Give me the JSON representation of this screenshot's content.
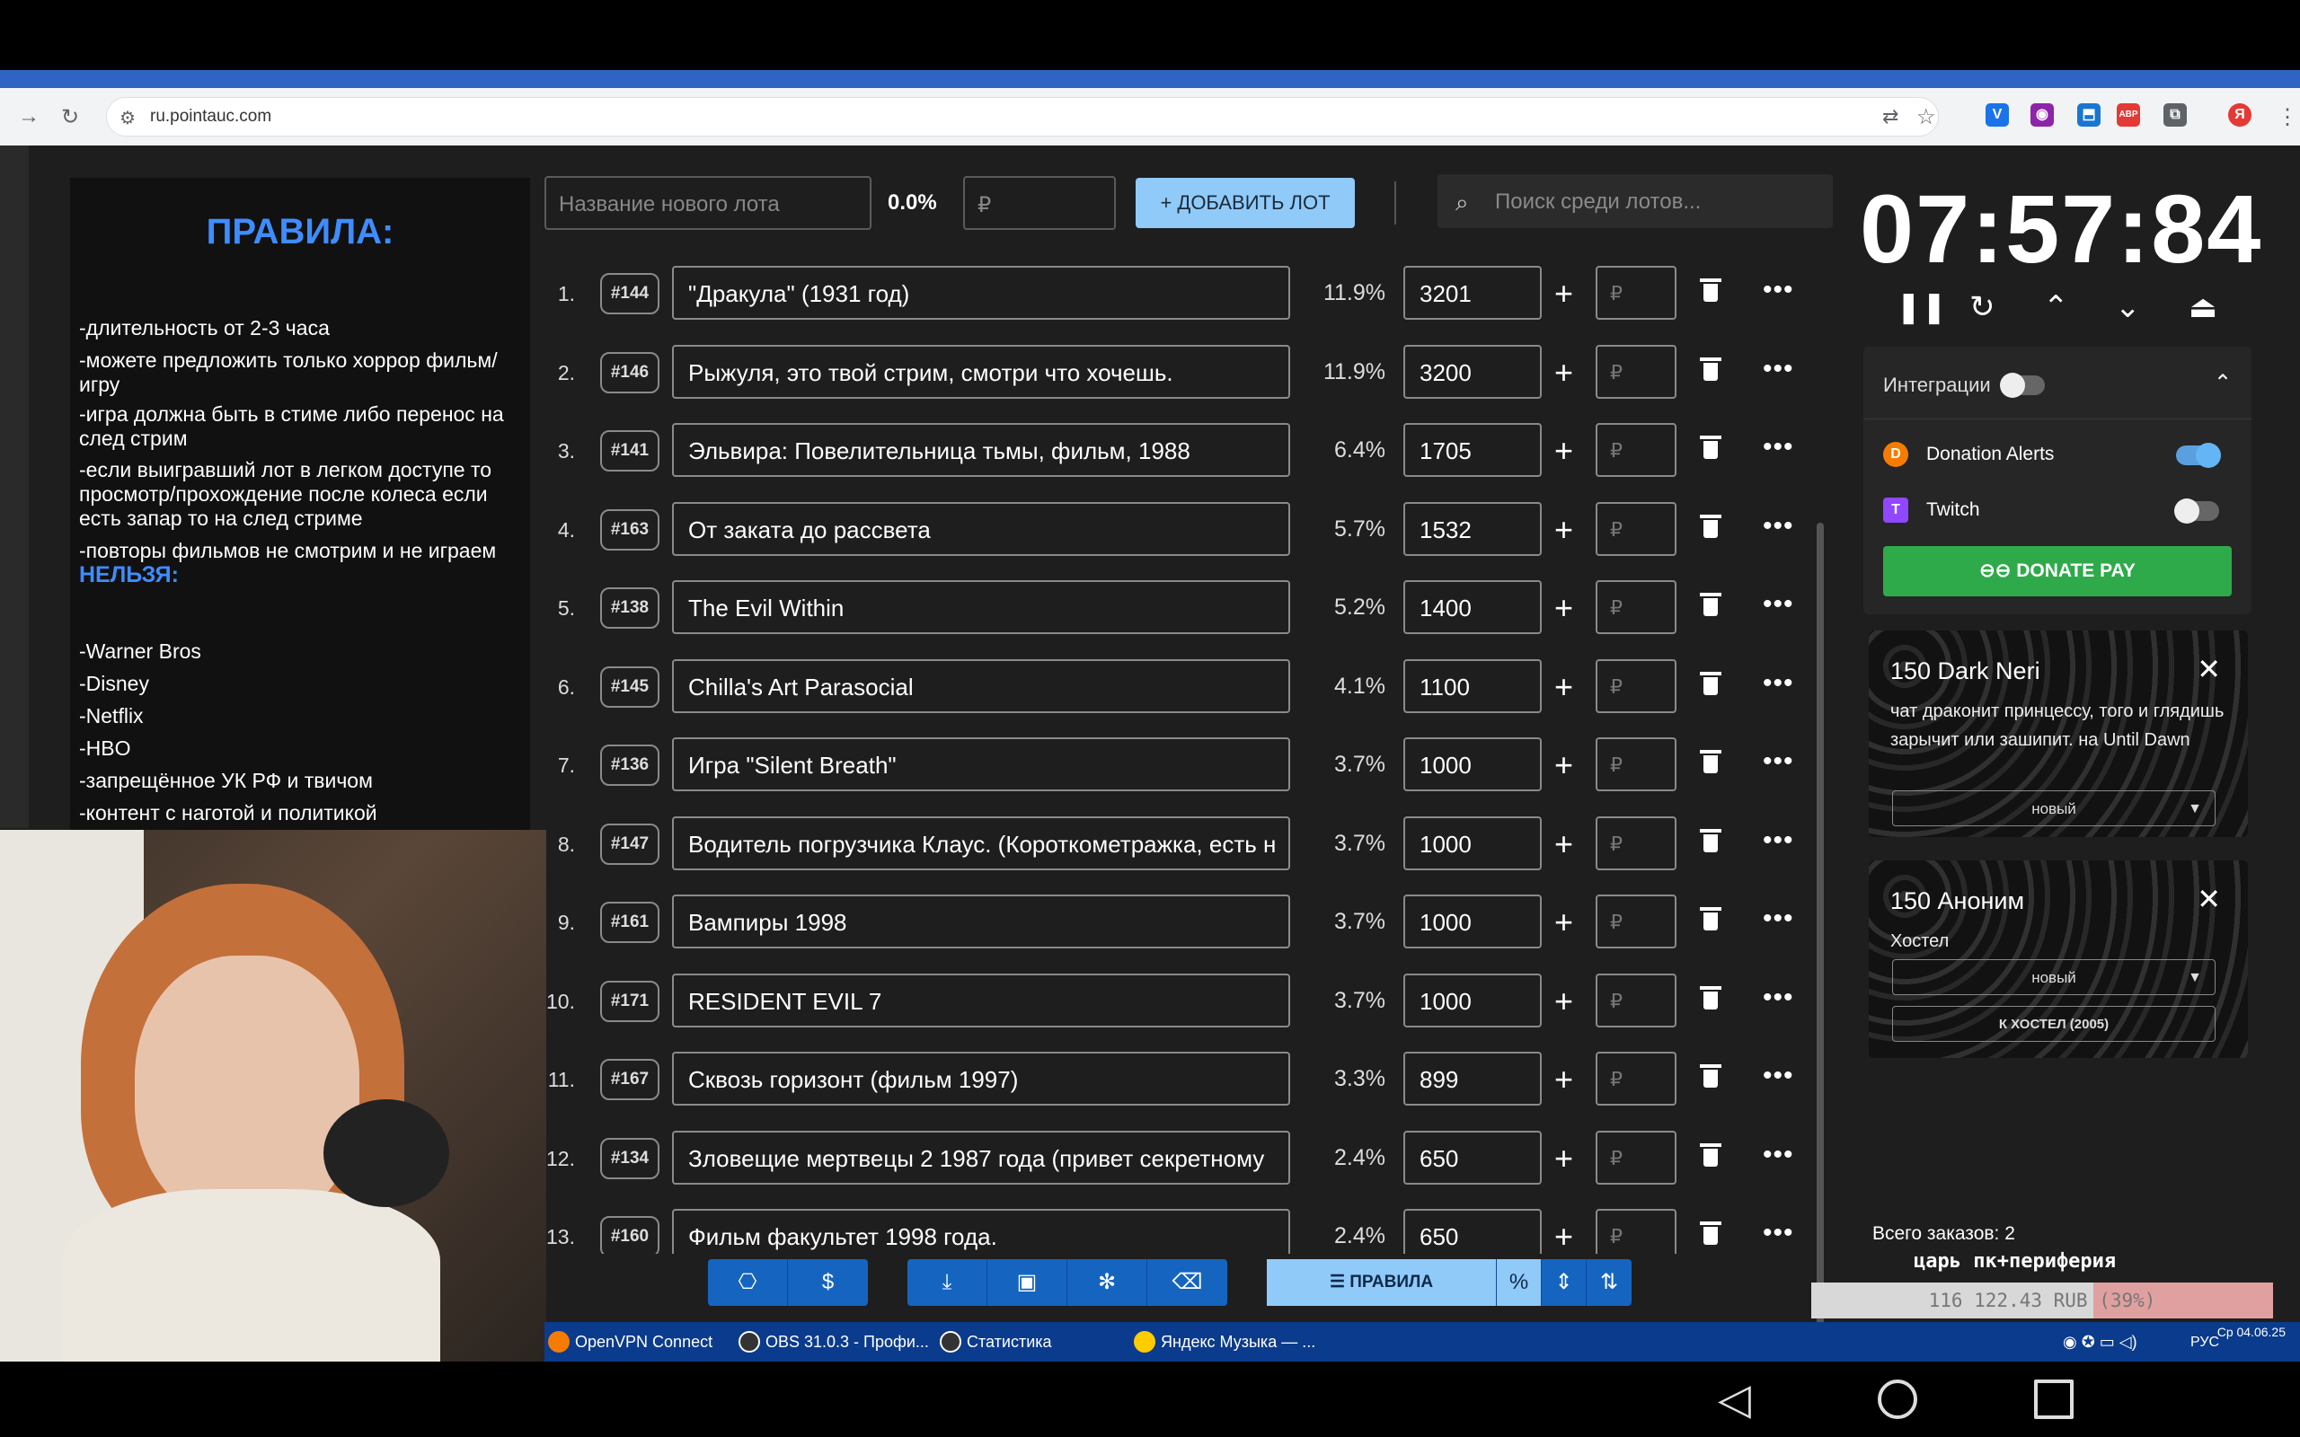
{
  "browser": {
    "url": "ru.pointauc.com",
    "extensions": [
      "V",
      "◉",
      "⬒",
      "ABP",
      "⧉",
      "Я"
    ]
  },
  "rules": {
    "title": "ПРАВИЛА:",
    "items": [
      "-длительность от 2-3 часа",
      "-можете предложить только хоррор фильм/игру",
      "-игра должна быть в стиме либо перенос на след стрим",
      "-если выигравший лот в легком доступе то просмотр/прохождение после колеса если есть запар то на след стриме",
      "-повторы фильмов не смотрим и не играем"
    ],
    "forbid_title": "НЕЛЬЗЯ:",
    "forbid_items": [
      "-Warner Bros",
      "-Disney",
      "-Netflix",
      "-HBO",
      "-запрещённое УК РФ и твичом",
      "-контент с наготой и политикой"
    ]
  },
  "toolbar": {
    "lot_name_placeholder": "Название нового лота",
    "total_percent": "0.0%",
    "price_placeholder": "₽",
    "add_lot_label": "ДОБАВИТЬ ЛОТ",
    "search_placeholder": "Поиск среди лотов..."
  },
  "lots": [
    {
      "num": "1.",
      "id": "#144",
      "name": "\"Дракула\" (1931 год)",
      "pct": "11.9%",
      "amount": "3201"
    },
    {
      "num": "2.",
      "id": "#146",
      "name": "Рыжуля, это твой стрим, смотри что хочешь.",
      "pct": "11.9%",
      "amount": "3200"
    },
    {
      "num": "3.",
      "id": "#141",
      "name": "Эльвира: Повелительница тьмы, фильм, 1988",
      "pct": "6.4%",
      "amount": "1705"
    },
    {
      "num": "4.",
      "id": "#163",
      "name": "От заката до рассвета",
      "pct": "5.7%",
      "amount": "1532"
    },
    {
      "num": "5.",
      "id": "#138",
      "name": "The Evil Within",
      "pct": "5.2%",
      "amount": "1400"
    },
    {
      "num": "6.",
      "id": "#145",
      "name": "Chilla's Art Parasocial",
      "pct": "4.1%",
      "amount": "1100"
    },
    {
      "num": "7.",
      "id": "#136",
      "name": "Игра \"Silent Breath\"",
      "pct": "3.7%",
      "amount": "1000"
    },
    {
      "num": "8.",
      "id": "#147",
      "name": "Водитель погрузчика Клаус. (Короткометражка, есть н",
      "pct": "3.7%",
      "amount": "1000"
    },
    {
      "num": "9.",
      "id": "#161",
      "name": "Вампиры 1998",
      "pct": "3.7%",
      "amount": "1000"
    },
    {
      "num": "10.",
      "id": "#171",
      "name": "RESIDENT EVIL 7",
      "pct": "3.7%",
      "amount": "1000"
    },
    {
      "num": "11.",
      "id": "#167",
      "name": "Сквозь горизонт (фильм 1997)",
      "pct": "3.3%",
      "amount": "899"
    },
    {
      "num": "12.",
      "id": "#134",
      "name": "Зловещие мертвецы 2  1987 года (привет секретному",
      "pct": "2.4%",
      "amount": "650"
    },
    {
      "num": "13.",
      "id": "#160",
      "name": "Фильм факультет 1998 года.",
      "pct": "2.4%",
      "amount": "650"
    }
  ],
  "lot_add_placeholder": "₽",
  "bottom_toolbar": {
    "rules_label": "ПРАВИЛА",
    "percent_label": "%"
  },
  "timer": "07:57:84",
  "integrations": {
    "title": "Интеграции",
    "donation_alerts": "Donation Alerts",
    "twitch": "Twitch",
    "donate_pay": "DONATE PAY"
  },
  "donations": [
    {
      "title": "150 Dark Neri",
      "message": "чат драконит принцессу, того и глядишь зарычит или зашипит. на Until Dawn",
      "status": "новый",
      "lot": ""
    },
    {
      "title": "150 Аноним",
      "message": "Хостел",
      "status": "новый",
      "lot": "К ХОСТЕЛ (2005)"
    }
  ],
  "total_orders": "Всего заказов: 2",
  "overlay": {
    "note": "царь пк+периферия",
    "goal_text": "116 122.43 RUB (39%)",
    "goal_progress": 0.39
  },
  "taskbar": {
    "tasks": [
      "OpenVPN Connect",
      "OBS 31.0.3 - Профи...",
      "Статистика",
      "Яндекс Музыка — ..."
    ],
    "lang": "РУС",
    "date": "Ср 04.06.25"
  }
}
